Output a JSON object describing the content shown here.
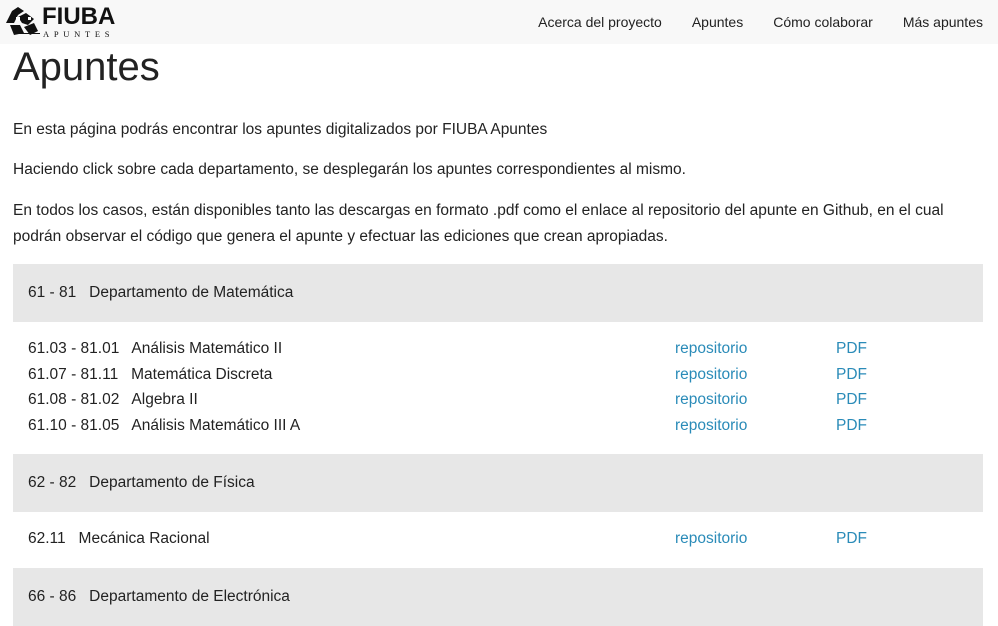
{
  "brand": {
    "name": "FIUBA",
    "subtitle": "APUNTES"
  },
  "nav": {
    "items": [
      {
        "label": "Acerca del proyecto"
      },
      {
        "label": "Apuntes"
      },
      {
        "label": "Cómo colaborar"
      },
      {
        "label": "Más apuntes"
      }
    ]
  },
  "page": {
    "title": "Apuntes",
    "paragraphs": [
      "En esta página podrás encontrar los apuntes digitalizados por FIUBA Apuntes",
      "Haciendo click sobre cada departamento, se desplegarán los apuntes correspondientes al mismo.",
      "En todos los casos, están disponibles tanto las descargas en formato .pdf como el enlace al repositorio del apunte en Github, en el cual podrán observar el código que genera el apunte y efectuar las ediciones que crean apropiadas."
    ]
  },
  "departments": [
    {
      "label": "61 - 81   Departamento de Matemática",
      "subjects": [
        {
          "label": "61.03 - 81.01   Análisis Matemático II",
          "repo": "repositorio",
          "pdf": "PDF"
        },
        {
          "label": "61.07 - 81.11   Matemática Discreta",
          "repo": "repositorio",
          "pdf": "PDF"
        },
        {
          "label": "61.08 - 81.02   Algebra II",
          "repo": "repositorio",
          "pdf": "PDF"
        },
        {
          "label": "61.10 - 81.05   Análisis Matemático III A",
          "repo": "repositorio",
          "pdf": "PDF"
        }
      ]
    },
    {
      "label": "62 - 82   Departamento de Física",
      "subjects": [
        {
          "label": "62.11   Mecánica Racional",
          "repo": "repositorio",
          "pdf": "PDF"
        }
      ]
    },
    {
      "label": "66 - 86   Departamento de Electrónica",
      "subjects": []
    }
  ],
  "colors": {
    "link": "#2a8bb8",
    "dept_header_bg": "#e7e7e7",
    "navbar_bg": "#f8f8f8"
  }
}
